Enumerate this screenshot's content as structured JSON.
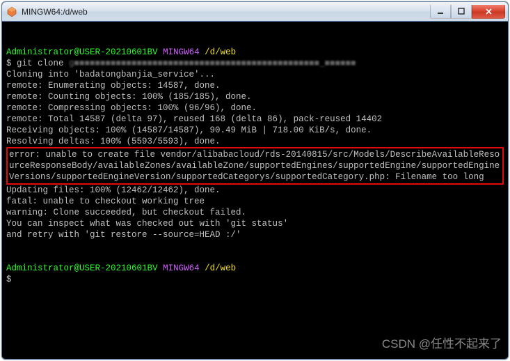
{
  "window": {
    "title": "MINGW64:/d/web"
  },
  "prompt": {
    "userhost": "Administrator@USER-20210601BV",
    "env": "MINGW64",
    "path": "/d/web"
  },
  "cmd": {
    "prefix": "$ git clone ",
    "url_blurred": "g■■■■■■■■■■■■■■■■■■■■■■■■■■■■■■■■■■■■■■■■■■■■■■■_■■■■■■"
  },
  "lines": {
    "l1": "Cloning into 'badatongbanjia_service'...",
    "l2": "remote: Enumerating objects: 14587, done.",
    "l3": "remote: Counting objects: 100% (185/185), done.",
    "l4": "remote: Compressing objects: 100% (96/96), done.",
    "l5": "remote: Total 14587 (delta 97), reused 168 (delta 86), pack-reused 14402",
    "l6": "Receiving objects: 100% (14587/14587), 90.49 MiB | 718.00 KiB/s, done.",
    "l7": "Resolving deltas: 100% (5593/5593), done.",
    "err": "error: unable to create file vendor/alibabacloud/rds-20140815/src/Models/DescribeAvailableResourceResponseBody/availableZones/availableZone/supportedEngines/supportedEngine/supportedEngineVersions/supportedEngineVersion/supportedCategorys/supportedCategory.php: Filename too long",
    "l8": "Updating files: 100% (12462/12462), done.",
    "l9": "fatal: unable to checkout working tree",
    "l10": "warning: Clone succeeded, but checkout failed.",
    "l11": "You can inspect what was checked out with 'git status'",
    "l12": "and retry with 'git restore --source=HEAD :/'",
    "blank": "",
    "dollar": "$"
  },
  "watermark": "CSDN @任性不起来了"
}
